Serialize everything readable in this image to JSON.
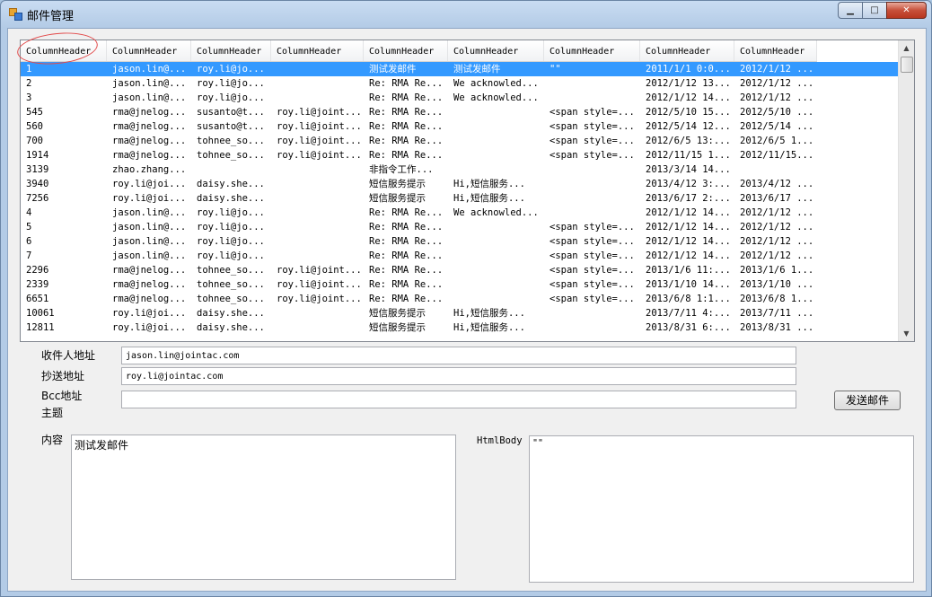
{
  "window": {
    "title": "邮件管理"
  },
  "list": {
    "headers": [
      "ColumnHeader",
      "ColumnHeader",
      "ColumnHeader",
      "ColumnHeader",
      "ColumnHeader",
      "ColumnHeader",
      "ColumnHeader",
      "ColumnHeader",
      "ColumnHeader"
    ],
    "rows": [
      [
        "1",
        "jason.lin@...",
        "roy.li@jo...",
        "",
        "测试发邮件",
        "测试发邮件",
        "\"\"",
        "2011/1/1 0:0...",
        "2012/1/12 ..."
      ],
      [
        "2",
        "jason.lin@...",
        "roy.li@jo...",
        "",
        "Re: RMA Re...",
        "We acknowled...",
        "",
        "2012/1/12 13...",
        "2012/1/12 ..."
      ],
      [
        "3",
        "jason.lin@...",
        "roy.li@jo...",
        "",
        "Re: RMA Re...",
        "We acknowled...",
        "",
        "2012/1/12 14...",
        "2012/1/12 ..."
      ],
      [
        "545",
        "rma@jnelog...",
        "susanto@t...",
        "roy.li@joint...",
        "Re: RMA Re...",
        "",
        "<span style=...",
        "2012/5/10 15...",
        "2012/5/10 ..."
      ],
      [
        "560",
        "rma@jnelog...",
        "susanto@t...",
        "roy.li@joint...",
        "Re: RMA Re...",
        "",
        "<span style=...",
        "2012/5/14 12...",
        "2012/5/14 ..."
      ],
      [
        "700",
        "rma@jnelog...",
        "tohnee_so...",
        "roy.li@joint...",
        "Re: RMA Re...",
        "",
        "<span style=...",
        "2012/6/5 13:...",
        "2012/6/5 1..."
      ],
      [
        "1914",
        "rma@jnelog...",
        "tohnee_so...",
        "roy.li@joint...",
        "Re: RMA Re...",
        "",
        "<span style=...",
        "2012/11/15 1...",
        "2012/11/15..."
      ],
      [
        "3139",
        "zhao.zhang...",
        "",
        "",
        "非指令工作...",
        "",
        "",
        "2013/3/14 14...",
        ""
      ],
      [
        "3940",
        "roy.li@joi...",
        "daisy.she...",
        "",
        "短信服务提示",
        "Hi,短信服务...",
        "",
        "2013/4/12 3:...",
        "2013/4/12 ..."
      ],
      [
        "7256",
        "roy.li@joi...",
        "daisy.she...",
        "",
        "短信服务提示",
        "Hi,短信服务...",
        "",
        "2013/6/17 2:...",
        "2013/6/17 ..."
      ],
      [
        "4",
        "jason.lin@...",
        "roy.li@jo...",
        "",
        "Re: RMA Re...",
        "We acknowled...",
        "",
        "2012/1/12 14...",
        "2012/1/12 ..."
      ],
      [
        "5",
        "jason.lin@...",
        "roy.li@jo...",
        "",
        "Re: RMA Re...",
        "",
        "<span style=...",
        "2012/1/12 14...",
        "2012/1/12 ..."
      ],
      [
        "6",
        "jason.lin@...",
        "roy.li@jo...",
        "",
        "Re: RMA Re...",
        "",
        "<span style=...",
        "2012/1/12 14...",
        "2012/1/12 ..."
      ],
      [
        "7",
        "jason.lin@...",
        "roy.li@jo...",
        "",
        "Re: RMA Re...",
        "",
        "<span style=...",
        "2012/1/12 14...",
        "2012/1/12 ..."
      ],
      [
        "2296",
        "rma@jnelog...",
        "tohnee_so...",
        "roy.li@joint...",
        "Re: RMA Re...",
        "",
        "<span style=...",
        "2013/1/6 11:...",
        "2013/1/6 1..."
      ],
      [
        "2339",
        "rma@jnelog...",
        "tohnee_so...",
        "roy.li@joint...",
        "Re: RMA Re...",
        "",
        "<span style=...",
        "2013/1/10 14...",
        "2013/1/10 ..."
      ],
      [
        "6651",
        "rma@jnelog...",
        "tohnee_so...",
        "roy.li@joint...",
        "Re: RMA Re...",
        "",
        "<span style=...",
        "2013/6/8 1:1...",
        "2013/6/8 1..."
      ],
      [
        "10061",
        "roy.li@joi...",
        "daisy.she...",
        "",
        "短信服务提示",
        "Hi,短信服务...",
        "",
        "2013/7/11 4:...",
        "2013/7/11 ..."
      ],
      [
        "12811",
        "roy.li@joi...",
        "daisy.she...",
        "",
        "短信服务提示",
        "Hi,短信服务...",
        "",
        "2013/8/31 6:...",
        "2013/8/31 ..."
      ]
    ]
  },
  "form": {
    "to_label": "收件人地址",
    "to_value": "jason.lin@jointac.com",
    "cc_label": "抄送地址",
    "cc_value": "roy.li@jointac.com",
    "bcc_label": "Bcc地址",
    "bcc_value": "",
    "subject_label": "主题",
    "send_button": "发送邮件",
    "content_label": "内容",
    "content_value": "测试发邮件",
    "htmlbody_label": "HtmlBody",
    "htmlbody_value": "\"\""
  }
}
